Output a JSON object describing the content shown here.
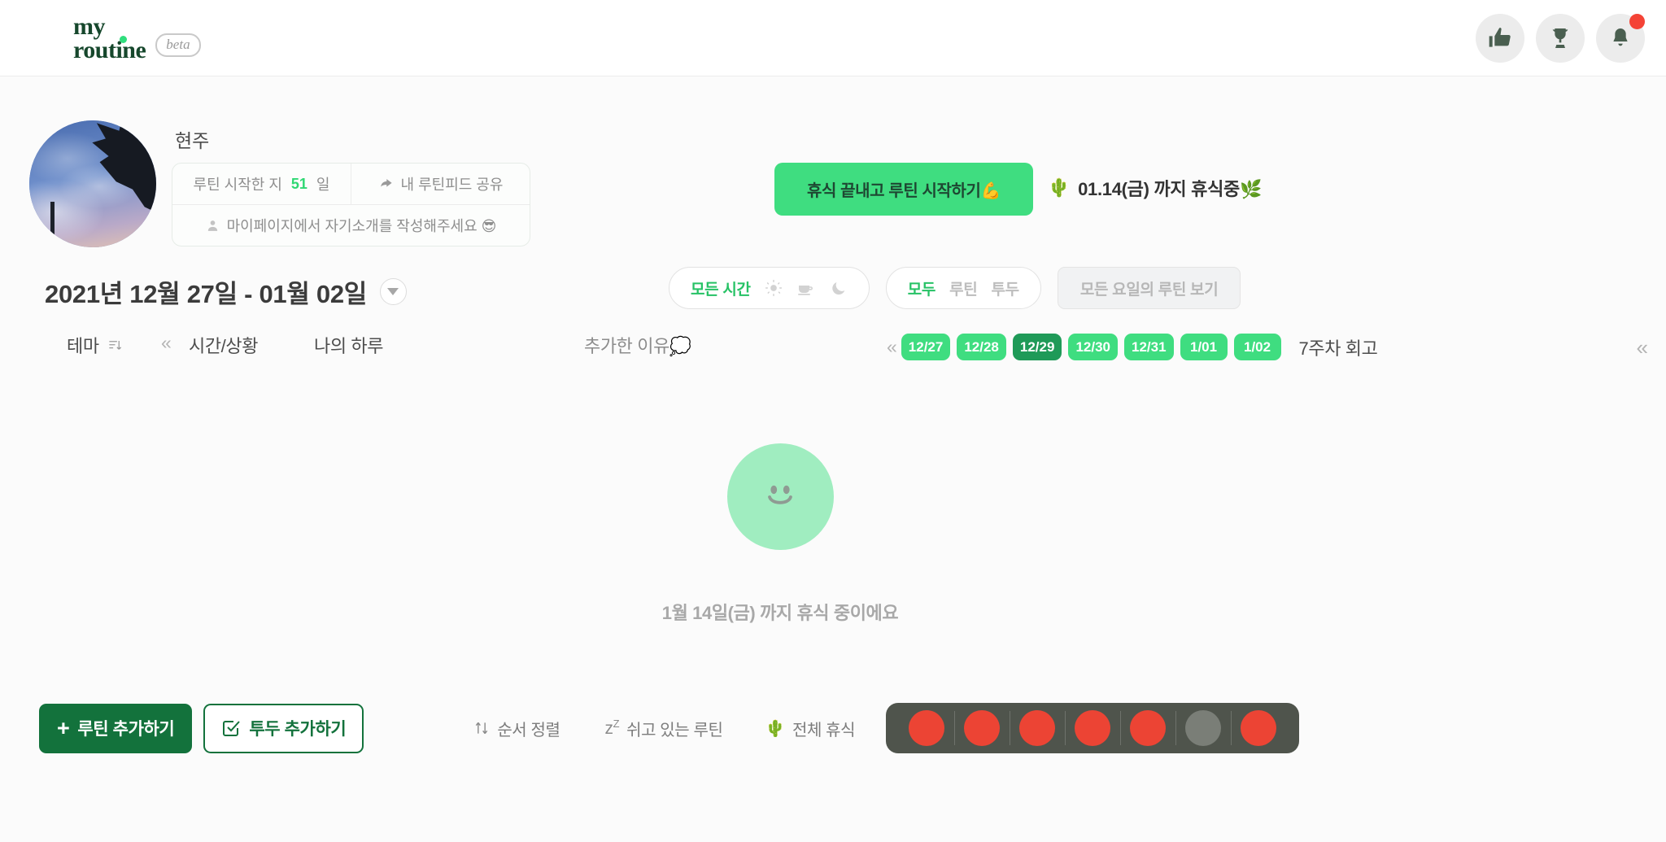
{
  "brand": {
    "line1": "my",
    "line2": "routine",
    "badge": "beta"
  },
  "topbar": {
    "icons": [
      {
        "name": "thumbs-up-icon",
        "label": "좋아요"
      },
      {
        "name": "trophy-icon",
        "label": "트로피"
      },
      {
        "name": "bell-icon",
        "label": "알림"
      }
    ]
  },
  "profile": {
    "username": "현주",
    "streak_prefix": "루틴 시작한 지",
    "streak_value": "51",
    "streak_suffix": "일",
    "share_label": "내 루틴피드 공유",
    "bio_prompt": "마이페이지에서 자기소개를 작성해주세요 😎"
  },
  "daterange": {
    "label": "2021년 12월 27일 - 01월 02일"
  },
  "cta": {
    "label": "휴식 끝내고 루틴 시작하기💪"
  },
  "rest_status": {
    "emoji": "🌵",
    "text": "01.14(금) 까지 휴식중🌿"
  },
  "filters": {
    "time": {
      "active": "모든 시간",
      "icons": [
        "sun-icon",
        "cup-icon",
        "moon-icon"
      ]
    },
    "type": {
      "active": "모두",
      "options": [
        "루틴",
        "투두"
      ]
    },
    "all_days_button": "모든 요일의 루틴 보기"
  },
  "columns": {
    "theme": "테마",
    "time_situation": "시간/상황",
    "my_day": "나의 하루",
    "reason": "추가한 이유💭"
  },
  "dates": {
    "chips": [
      {
        "label": "12/27",
        "today": false
      },
      {
        "label": "12/28",
        "today": false
      },
      {
        "label": "12/29",
        "today": true
      },
      {
        "label": "12/30",
        "today": false
      },
      {
        "label": "12/31",
        "today": false
      },
      {
        "label": "1/01",
        "today": false
      },
      {
        "label": "1/02",
        "today": false
      }
    ],
    "retro_label": "7주차 회고"
  },
  "empty_state": {
    "face": "smiley-face-icon",
    "text": "1월 14일(금) 까지 휴식 중이에요"
  },
  "bottombar": {
    "add_routine": "루틴 추가하기",
    "add_todo": "투두 추가하기",
    "sort": "순서 정렬",
    "resting_routines": "쉬고 있는 루틴",
    "rest_all": "전체 휴식",
    "rest_all_emoji": "🌵",
    "day_dots": [
      {
        "state": "on"
      },
      {
        "state": "on"
      },
      {
        "state": "on"
      },
      {
        "state": "on"
      },
      {
        "state": "on"
      },
      {
        "state": "off"
      },
      {
        "state": "on"
      }
    ]
  },
  "colors": {
    "brand_green": "#13723c",
    "accent_green": "#3fdd80",
    "today_green": "#1f9a58",
    "dot_red": "#ec4434",
    "dot_off": "#7a7e77"
  }
}
